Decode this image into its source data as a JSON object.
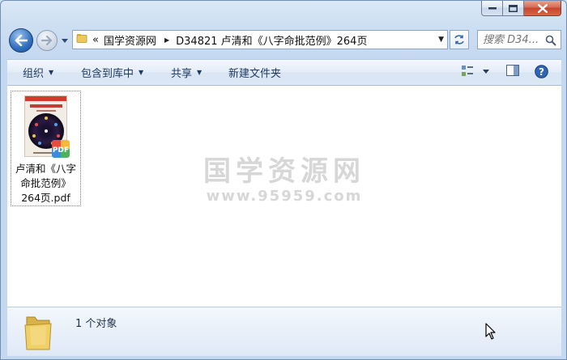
{
  "window": {
    "caption_buttons": {
      "minimize": "minimize",
      "maximize": "maximize",
      "close": "close"
    }
  },
  "address_bar": {
    "overflow": "«",
    "crumbs": [
      "国学资源网",
      "D34821 卢清和《八字命批范例》264页"
    ]
  },
  "search": {
    "placeholder": "搜索 D34..."
  },
  "toolbar": {
    "organize": "组织",
    "include_in_library": "包含到库中",
    "share": "共享",
    "new_folder": "新建文件夹"
  },
  "files": [
    {
      "name": "卢清和《八字命批范例》264页.pdf",
      "type": "pdf",
      "badge": "PDF"
    }
  ],
  "watermark": {
    "line1": "国学资源网",
    "line2": "www.95959.com"
  },
  "status": {
    "count_text": "1 个对象"
  },
  "colors": {
    "accent": "#2f6fbd",
    "toolbar_text": "#1e395b",
    "close_red": "#c7442a"
  }
}
